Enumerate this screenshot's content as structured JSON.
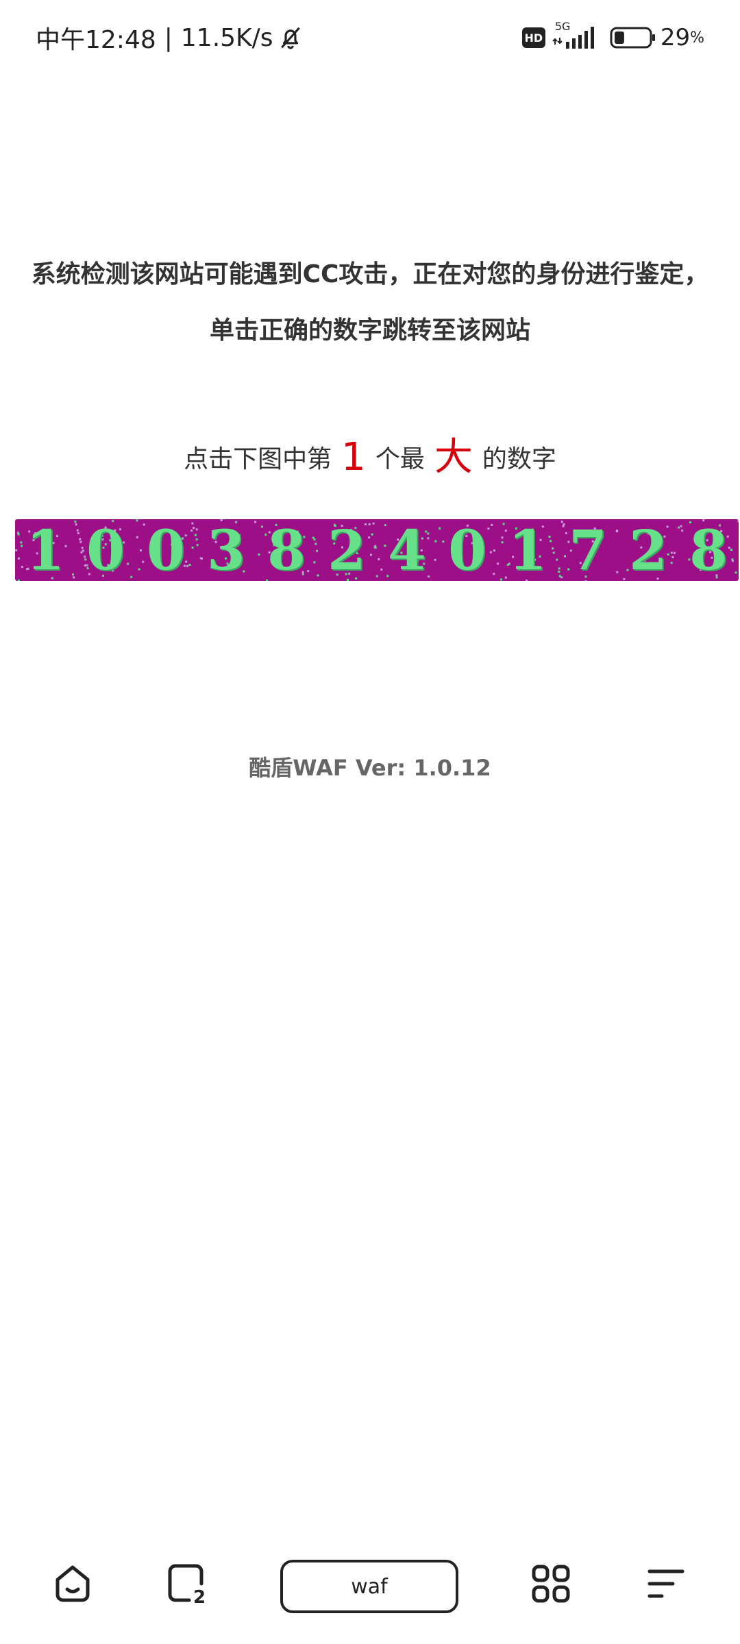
{
  "status_bar": {
    "time": "中午12:48",
    "separator": "|",
    "net_speed": "11.5K/s",
    "hd_label": "HD",
    "network_type": "5G",
    "battery_percent": "29",
    "battery_level": 0.29,
    "battery_suffix": "%"
  },
  "content": {
    "notice": "系统检测该网站可能遇到CC攻击，正在对您的身份进行鉴定，单击正确的数字跳转至该网站",
    "instruction": {
      "prefix": "点击下图中第",
      "position": "1",
      "middle": "个最",
      "superlative": "大",
      "suffix": "的数字"
    },
    "captcha": {
      "background_color": "#9c0f86",
      "digit_color": "#66e089",
      "digits": [
        "1",
        "0",
        "0",
        "3",
        "8",
        "2",
        "4",
        "0",
        "1",
        "7",
        "2",
        "8"
      ]
    },
    "version": "酷盾WAF Ver: 1.0.12"
  },
  "bottom_nav": {
    "home_icon": "home-icon",
    "tabs_icon": "tabs-icon",
    "tabs_count": "2",
    "address_text": "waf",
    "apps_icon": "apps-grid-icon",
    "menu_icon": "menu-icon"
  }
}
